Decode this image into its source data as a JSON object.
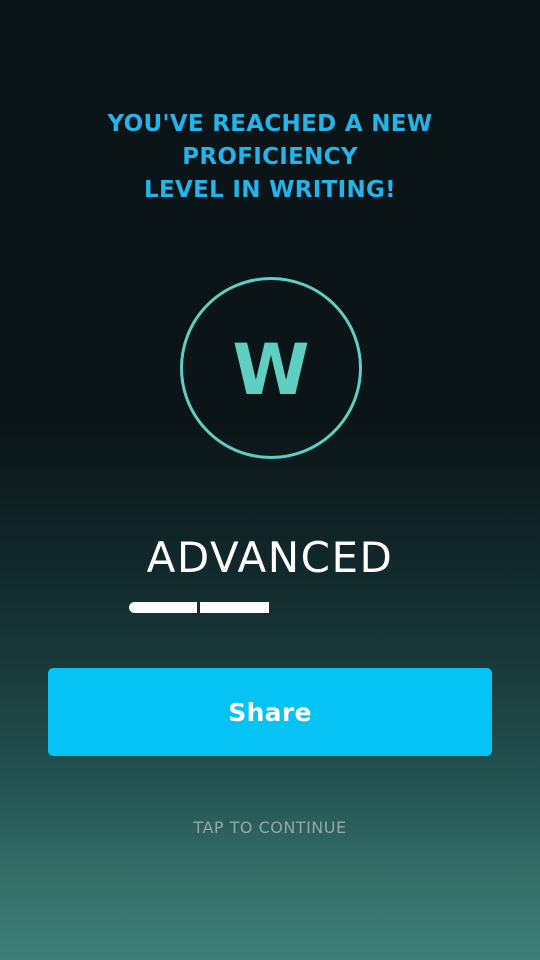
{
  "headline": {
    "line1": "YOU'VE REACHED A NEW PROFICIENCY",
    "line2": "LEVEL IN WRITING!"
  },
  "badge": {
    "letter": "W",
    "color": "#5fcfc2"
  },
  "level": {
    "name": "ADVANCED",
    "progress_segments_filled": 2
  },
  "share_button": {
    "label": "Share",
    "color": "#06c3f6"
  },
  "continue_prompt": {
    "label": "TAP TO CONTINUE"
  },
  "colors": {
    "headline": "#24b4ea",
    "background_top": "#0b1416",
    "background_bottom": "#3d7f77"
  }
}
